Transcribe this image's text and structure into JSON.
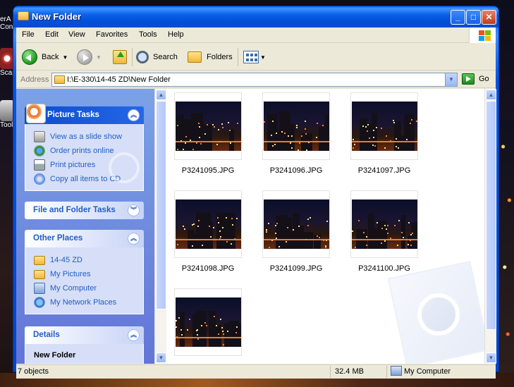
{
  "window": {
    "title": "New Folder"
  },
  "desktop": {
    "icon_labels": [
      "erA",
      "Con",
      "Scap",
      "Tools"
    ]
  },
  "menu": [
    "File",
    "Edit",
    "View",
    "Favorites",
    "Tools",
    "Help"
  ],
  "toolbar": {
    "back_label": "Back",
    "search_label": "Search",
    "folders_label": "Folders"
  },
  "address": {
    "label": "Address",
    "value": "I:\\E-330\\14-45 ZD\\New Folder",
    "go_label": "Go"
  },
  "taskpane": {
    "picture_tasks": {
      "title": "Picture Tasks",
      "items": [
        "View as a slide show",
        "Order prints online",
        "Print pictures",
        "Copy all items to CD"
      ]
    },
    "file_folder_tasks": {
      "title": "File and Folder Tasks"
    },
    "other_places": {
      "title": "Other Places",
      "items": [
        "14-45 ZD",
        "My Pictures",
        "My Computer",
        "My Network Places"
      ]
    },
    "details": {
      "title": "Details",
      "name": "New Folder"
    }
  },
  "files": [
    {
      "name": "P3241095.JPG"
    },
    {
      "name": "P3241096.JPG"
    },
    {
      "name": "P3241097.JPG"
    },
    {
      "name": "P3241098.JPG"
    },
    {
      "name": "P3241099.JPG"
    },
    {
      "name": "P3241100.JPG"
    },
    {
      "name": ""
    }
  ],
  "status": {
    "objects": "7 objects",
    "size": "32.4 MB",
    "location": "My Computer"
  },
  "colors": {
    "titlebar": "#0054e3",
    "taskpane_link": "#215dc6",
    "status_bg": "#ece9d8"
  }
}
